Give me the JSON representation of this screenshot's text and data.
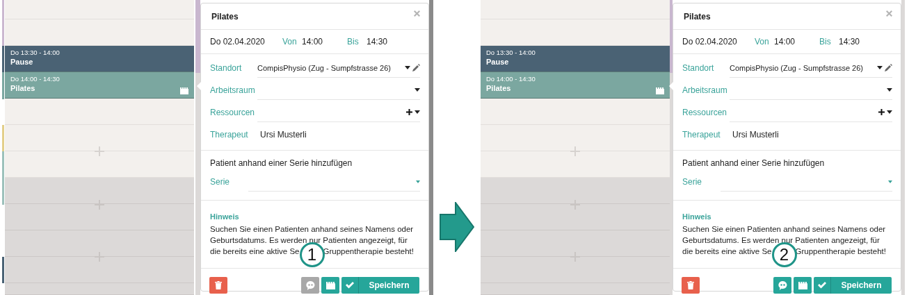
{
  "panels": [
    {
      "callout": "1",
      "calendar": {
        "events": [
          {
            "time": "Do 13:30 - 14:00",
            "title": "Pause",
            "color": "#4a6274",
            "series": false
          },
          {
            "time": "Do 14:00 - 14:30",
            "title": "Pilates",
            "color": "#7ba7a0",
            "series": true
          }
        ]
      },
      "popup": {
        "title": "Pilates",
        "date": "Do 02.04.2020",
        "from_label": "Von",
        "from": "14:00",
        "to_label": "Bis",
        "to": "14:30",
        "fields": [
          {
            "kind": "select",
            "label": "Standort",
            "value": "CompisPhysio (Zug - Sumpfstrasse 26)",
            "editable": true
          },
          {
            "kind": "select",
            "label": "Arbeitsraum",
            "editable": false
          },
          {
            "kind": "multi",
            "label": "Ressourcen",
            "editable": false
          },
          {
            "kind": "text",
            "label": "Therapeut",
            "value": "Ursi Musterli",
            "editable": false
          }
        ],
        "series_prompt": "Patient anhand einer Serie hinzufügen",
        "series_field": {
          "label": "Serie"
        },
        "hint_title": "Hinweis",
        "hint": [
          "Suchen Sie einen Patienten anhand seines Namens oder Geburtsdatums. Es werden nur Patienten angezeigt, für",
          "die bereits eine aktive Se",
          "Gruppentherapie besteht!"
        ],
        "buttons": [
          {
            "kind": "delete",
            "disabled": false
          },
          {
            "kind": "comment",
            "disabled": true
          },
          {
            "kind": "series",
            "disabled": false
          },
          {
            "kind": "save",
            "label": "Speichern",
            "disabled": false
          }
        ]
      }
    },
    {
      "callout": "2",
      "calendar": {
        "events": [
          {
            "time": "Do 13:30 - 14:00",
            "title": "Pause",
            "color": "#4a6274",
            "series": false
          },
          {
            "time": "Do 14:00 - 14:30",
            "title": "Pilates",
            "color": "#7ba7a0",
            "series": true
          }
        ]
      },
      "popup": {
        "title": "Pilates",
        "date": "Do 02.04.2020",
        "from_label": "Von",
        "from": "14:00",
        "to_label": "Bis",
        "to": "14:30",
        "fields": [
          {
            "kind": "select",
            "label": "Standort",
            "value": "CompisPhysio (Zug - Sumpfstrasse 26)",
            "editable": true
          },
          {
            "kind": "select",
            "label": "Arbeitsraum",
            "editable": false
          },
          {
            "kind": "multi",
            "label": "Ressourcen",
            "editable": false
          },
          {
            "kind": "text",
            "label": "Therapeut",
            "value": "Ursi Musterli",
            "editable": false
          }
        ],
        "series_prompt": "Patient anhand einer Serie hinzufügen",
        "series_field": {
          "label": "Serie"
        },
        "hint_title": "Hinweis",
        "hint": [
          "Suchen Sie einen Patienten anhand seines Namens oder Geburtsdatums. Es werden nur Patienten angezeigt, für",
          "die bereits eine aktive Se",
          "Gruppentherapie besteht!"
        ],
        "buttons": [
          {
            "kind": "delete",
            "disabled": false
          },
          {
            "kind": "comment",
            "disabled": false
          },
          {
            "kind": "series",
            "disabled": false
          },
          {
            "kind": "save",
            "label": "Speichern",
            "disabled": false
          }
        ]
      }
    }
  ]
}
